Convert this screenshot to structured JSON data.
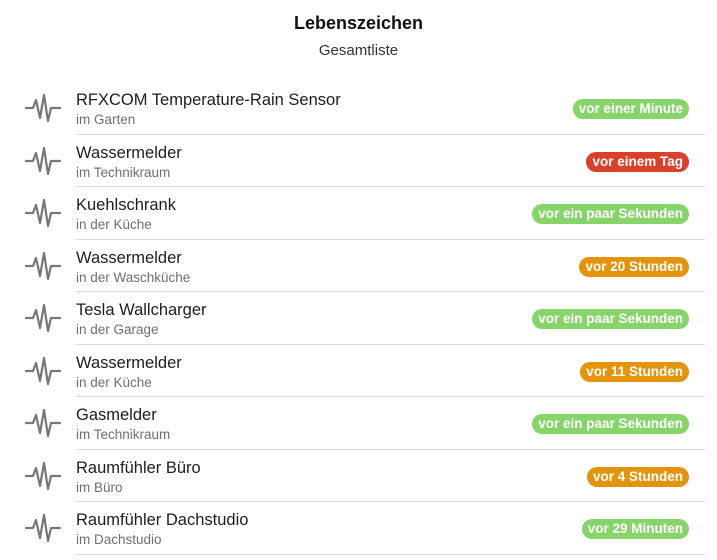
{
  "header": {
    "title": "Lebenszeichen",
    "subtitle": "Gesamtliste"
  },
  "colors": {
    "green": "#87d56a",
    "red": "#d9412b",
    "orange": "#e2940d"
  },
  "items": [
    {
      "name": "RFXCOM Temperature-Rain Sensor",
      "location": "im Garten",
      "status": "vor einer Minute",
      "status_color": "green",
      "icon": "heartbeat-icon"
    },
    {
      "name": "Wassermelder",
      "location": "im Technikraum",
      "status": "vor einem Tag",
      "status_color": "red",
      "icon": "heartbeat-icon"
    },
    {
      "name": "Kuehlschrank",
      "location": "in der Küche",
      "status": "vor ein paar Sekunden",
      "status_color": "green",
      "icon": "heartbeat-icon"
    },
    {
      "name": "Wassermelder",
      "location": "in der Waschküche",
      "status": "vor 20 Stunden",
      "status_color": "orange",
      "icon": "heartbeat-icon"
    },
    {
      "name": "Tesla Wallcharger",
      "location": "in der Garage",
      "status": "vor ein paar Sekunden",
      "status_color": "green",
      "icon": "heartbeat-icon"
    },
    {
      "name": "Wassermelder",
      "location": "in der Küche",
      "status": "vor 11 Stunden",
      "status_color": "orange",
      "icon": "heartbeat-icon"
    },
    {
      "name": "Gasmelder",
      "location": "im Technikraum",
      "status": "vor ein paar Sekunden",
      "status_color": "green",
      "icon": "heartbeat-icon"
    },
    {
      "name": "Raumfühler Büro",
      "location": "im Büro",
      "status": "vor 4 Stunden",
      "status_color": "orange",
      "icon": "heartbeat-icon"
    },
    {
      "name": "Raumfühler Dachstudio",
      "location": "im Dachstudio",
      "status": "vor 29 Minuten",
      "status_color": "green",
      "icon": "heartbeat-icon"
    }
  ]
}
